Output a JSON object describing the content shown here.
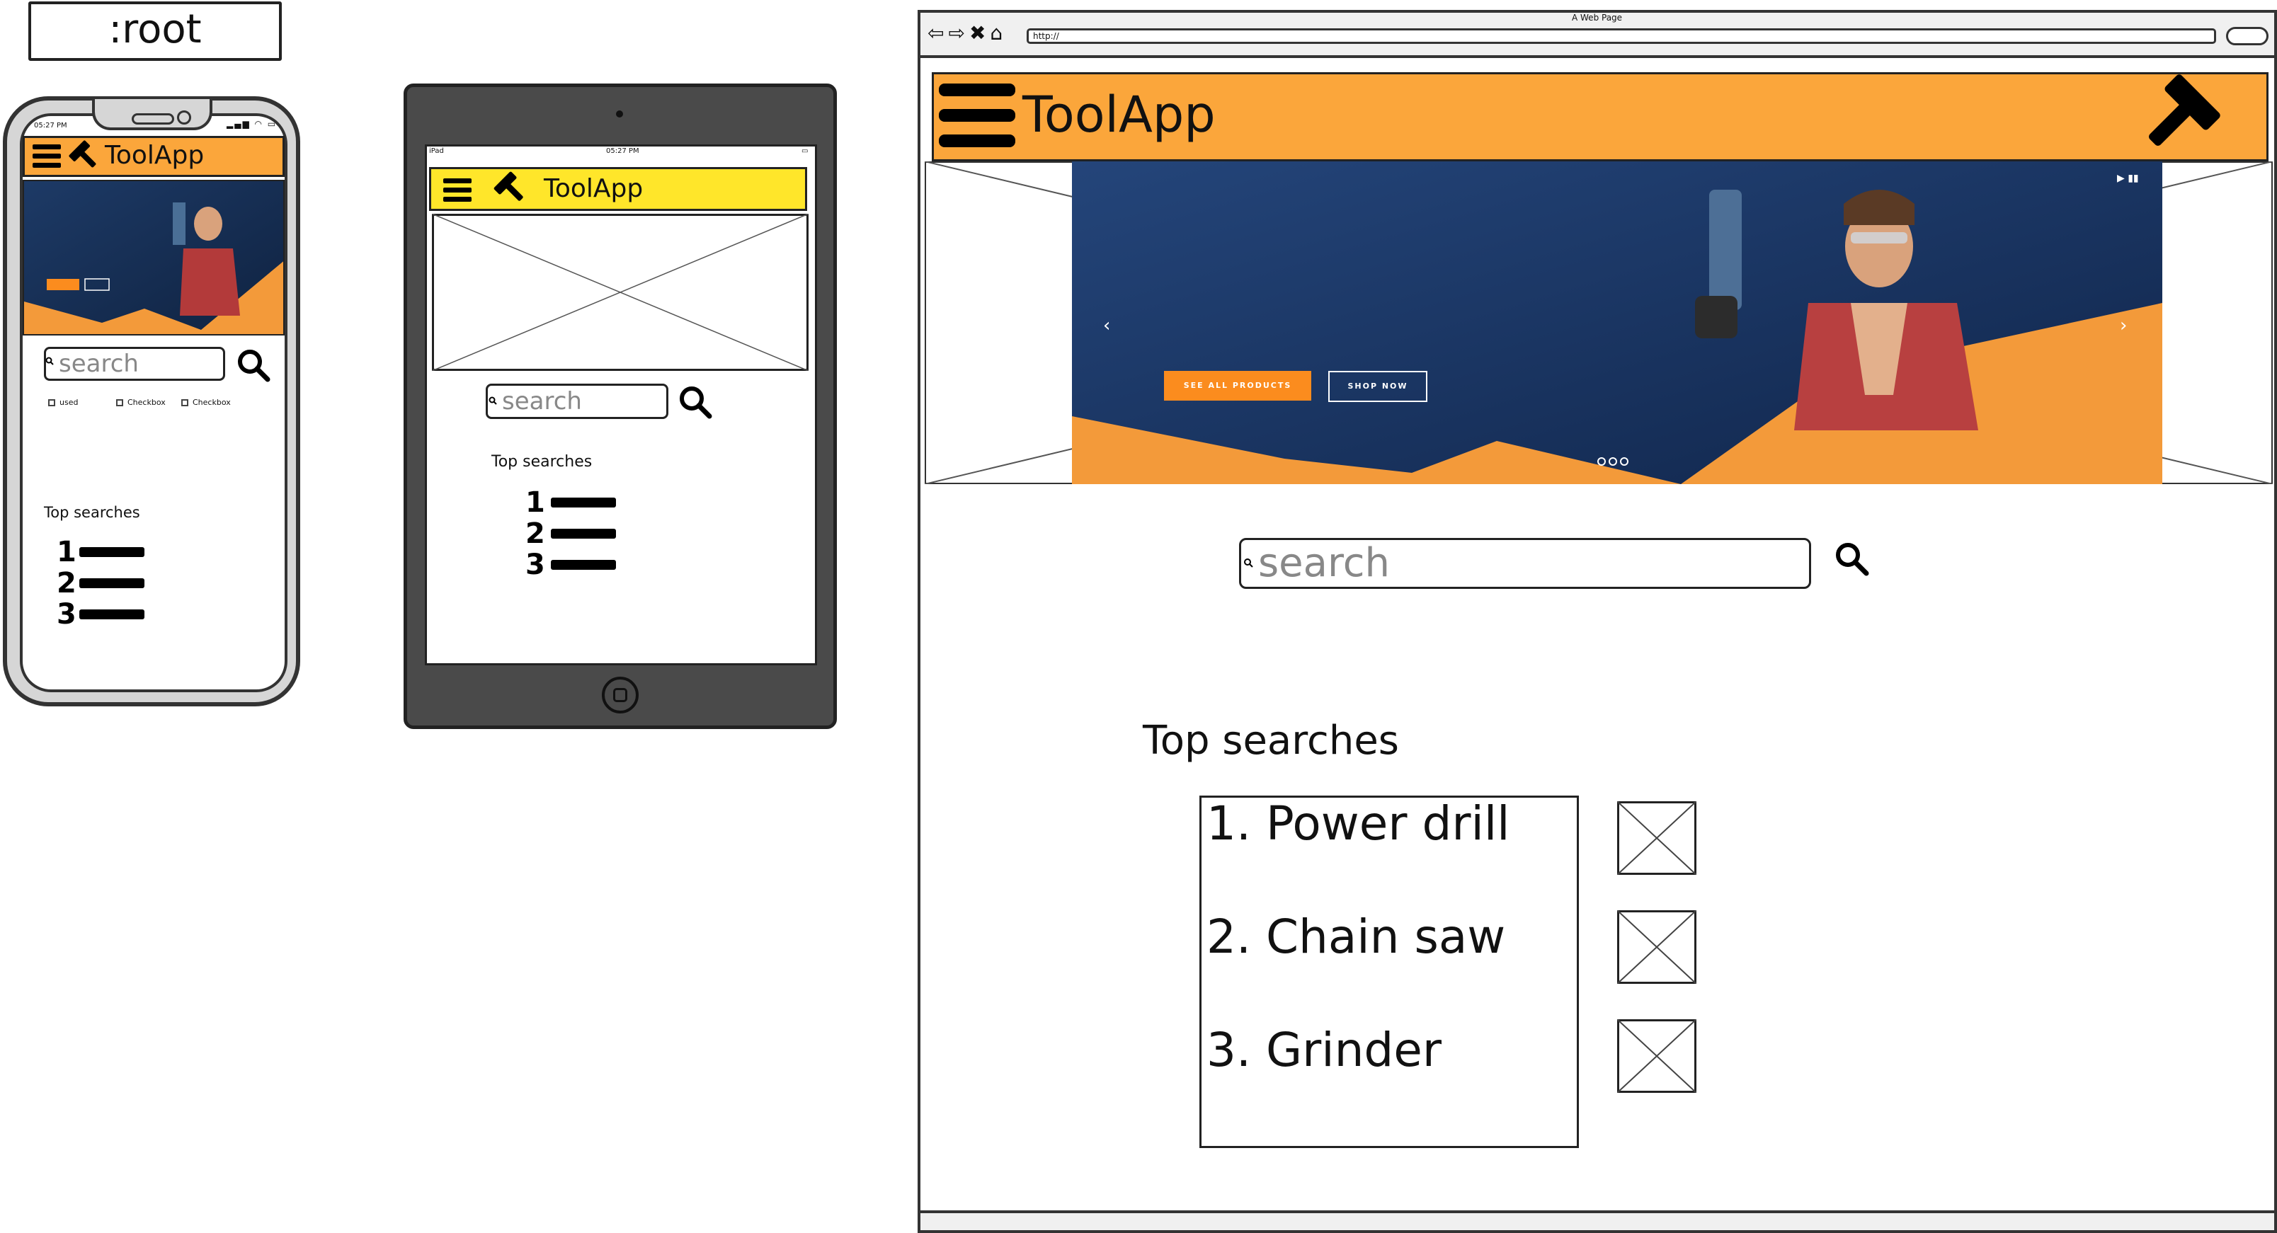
{
  "root_label": ":root",
  "brand": {
    "app_name": "ToolApp",
    "orange": "#fba63b",
    "yellow": "#ffe62a"
  },
  "phone": {
    "status_time": "05:27 PM",
    "search_placeholder": "search",
    "checkboxes": [
      "used",
      "Checkbox",
      "Checkbox"
    ],
    "top_searches_label": "Top searches",
    "list_numbers": [
      "1",
      "2",
      "3"
    ]
  },
  "tablet": {
    "status_left": "iPad",
    "status_time": "05:27 PM",
    "search_placeholder": "search",
    "top_searches_label": "Top searches",
    "list_numbers": [
      "1",
      "2",
      "3"
    ]
  },
  "browser": {
    "window_title": "A Web Page",
    "url": "http://",
    "search_placeholder": "search",
    "top_searches_label": "Top searches",
    "top_searches": [
      "1. Power drill",
      "2. Chain saw",
      "3. Grinder"
    ],
    "hero": {
      "see_all_label": "SEE ALL PRODUCTS",
      "shop_now_label": "SHOP NOW"
    }
  }
}
